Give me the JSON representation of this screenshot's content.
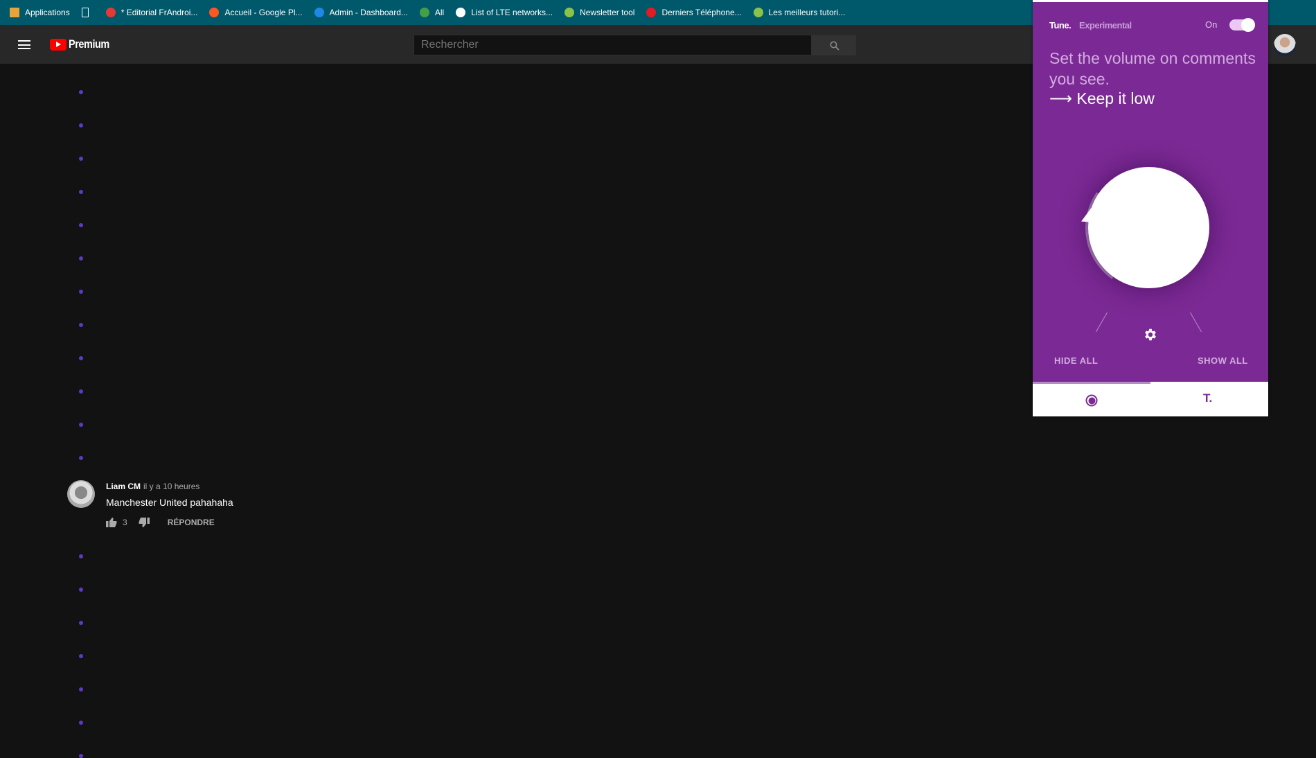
{
  "bookmarks": [
    {
      "label": "Applications",
      "icon": "apps-grid-icon",
      "color": "#e8a33a"
    },
    {
      "label": "",
      "icon": "page-icon",
      "color": "#ffffff"
    },
    {
      "label": "* Editorial FrAndroi...",
      "icon": "frandroid-icon",
      "color": "#e53935"
    },
    {
      "label": "Accueil - Google Pl...",
      "icon": "google-play-music-icon",
      "color": "#ff5722"
    },
    {
      "label": "Admin - Dashboard...",
      "icon": "dashboard-icon",
      "color": "#1e88e5"
    },
    {
      "label": "All",
      "icon": "feedly-icon",
      "color": "#43a047"
    },
    {
      "label": "List of LTE networks...",
      "icon": "wikipedia-icon",
      "color": "#ffffff"
    },
    {
      "label": "Newsletter tool",
      "icon": "newsletter-icon",
      "color": "#8bc34a"
    },
    {
      "label": "Derniers Téléphone...",
      "icon": "ta-icon",
      "color": "#e41b23"
    },
    {
      "label": "Les meilleurs tutori...",
      "icon": "tutorial-icon",
      "color": "#8bc34a"
    }
  ],
  "header": {
    "logo": "Premium",
    "search_placeholder": "Rechercher"
  },
  "comment": {
    "author": "Liam CM",
    "time": "il y a 10 heures",
    "text": "Manchester United pahahaha",
    "likes": "3",
    "reply": "RÉPONDRE"
  },
  "tune": {
    "brand": "Tune.",
    "badge": "Experimental",
    "toggle_label": "On",
    "toggle_on": true,
    "headline": "Set the volume on comments you see.",
    "cta": "⟶ Keep it low",
    "hide_all": "HIDE ALL",
    "show_all": "SHOW ALL",
    "tab_t": "T.",
    "accent": "#7b2994"
  }
}
